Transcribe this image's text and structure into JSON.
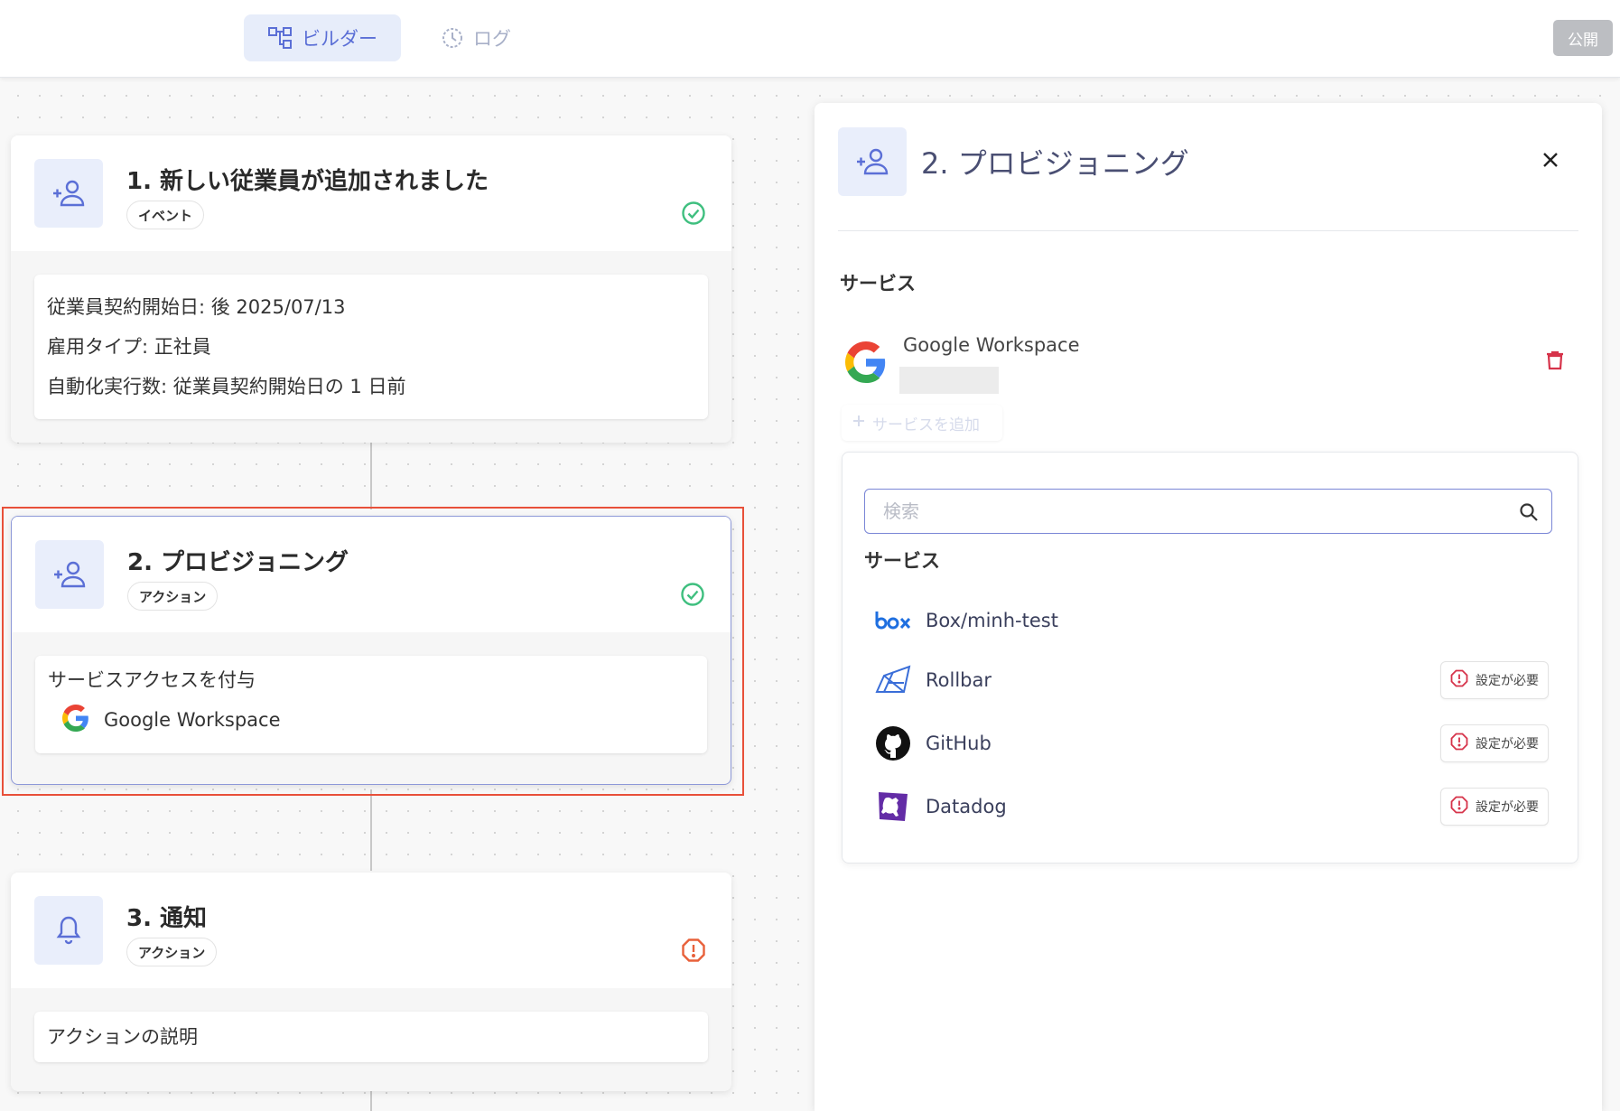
{
  "topbar": {
    "tabs": [
      {
        "label": "ビルダー",
        "icon": "flow-icon",
        "active": true
      },
      {
        "label": "ログ",
        "icon": "history-icon",
        "active": false
      }
    ],
    "publish_label": "公開"
  },
  "flow": {
    "cards": [
      {
        "title": "1. 新しい従業員が追加されました",
        "tag": "イベント",
        "icon": "person-add-icon",
        "status": "success",
        "details": [
          "従業員契約開始日: 後 2025/07/13",
          "雇用タイプ: 正社員",
          "自動化実行数: 従業員契約開始日の 1 日前"
        ]
      },
      {
        "title": "2. プロビジョニング",
        "tag": "アクション",
        "icon": "person-add-icon",
        "status": "success",
        "selected": true,
        "details": [
          "サービスアクセスを付与"
        ],
        "service": "Google Workspace"
      },
      {
        "title": "3. 通知",
        "tag": "アクション",
        "icon": "bell-icon",
        "status": "warning",
        "details": [
          "アクションの説明"
        ]
      }
    ]
  },
  "panel": {
    "title": "2. プロビジョニング",
    "service_section_label": "サービス",
    "selected_service": "Google Workspace",
    "add_service_label": "サービスを追加",
    "dropdown": {
      "search_placeholder": "検索",
      "section_label": "サービス",
      "options": [
        {
          "label": "Box/minh-test",
          "logo": "box-logo-icon",
          "badge": null
        },
        {
          "label": "Rollbar",
          "logo": "rollbar-logo-icon",
          "badge": "設定が必要"
        },
        {
          "label": "GitHub",
          "logo": "github-logo-icon",
          "badge": "設定が必要"
        },
        {
          "label": "Datadog",
          "logo": "datadog-logo-icon",
          "badge": "設定が必要"
        }
      ]
    }
  },
  "colors": {
    "accent": "#5b6fd6",
    "success": "#3fbf7f",
    "warning": "#e8603a",
    "danger": "#d6334a",
    "selection_outline": "#e8503a"
  }
}
